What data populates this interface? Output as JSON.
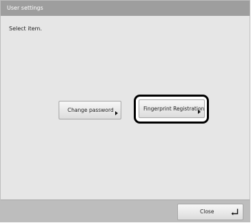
{
  "window": {
    "title": "User settings"
  },
  "main": {
    "instruction": "Select item.",
    "buttons": {
      "change_password": "Change password",
      "fingerprint_registration": "Fingerprint Registration"
    }
  },
  "footer": {
    "close_label": "Close"
  },
  "icons": {
    "submenu_arrow": "triangle-right-icon",
    "close_arrow": "return-arrow-icon"
  },
  "colors": {
    "titlebar": "#9e9e9e",
    "background": "#e6e6e6",
    "footer": "#bdbdbd",
    "highlight": "#000000"
  }
}
